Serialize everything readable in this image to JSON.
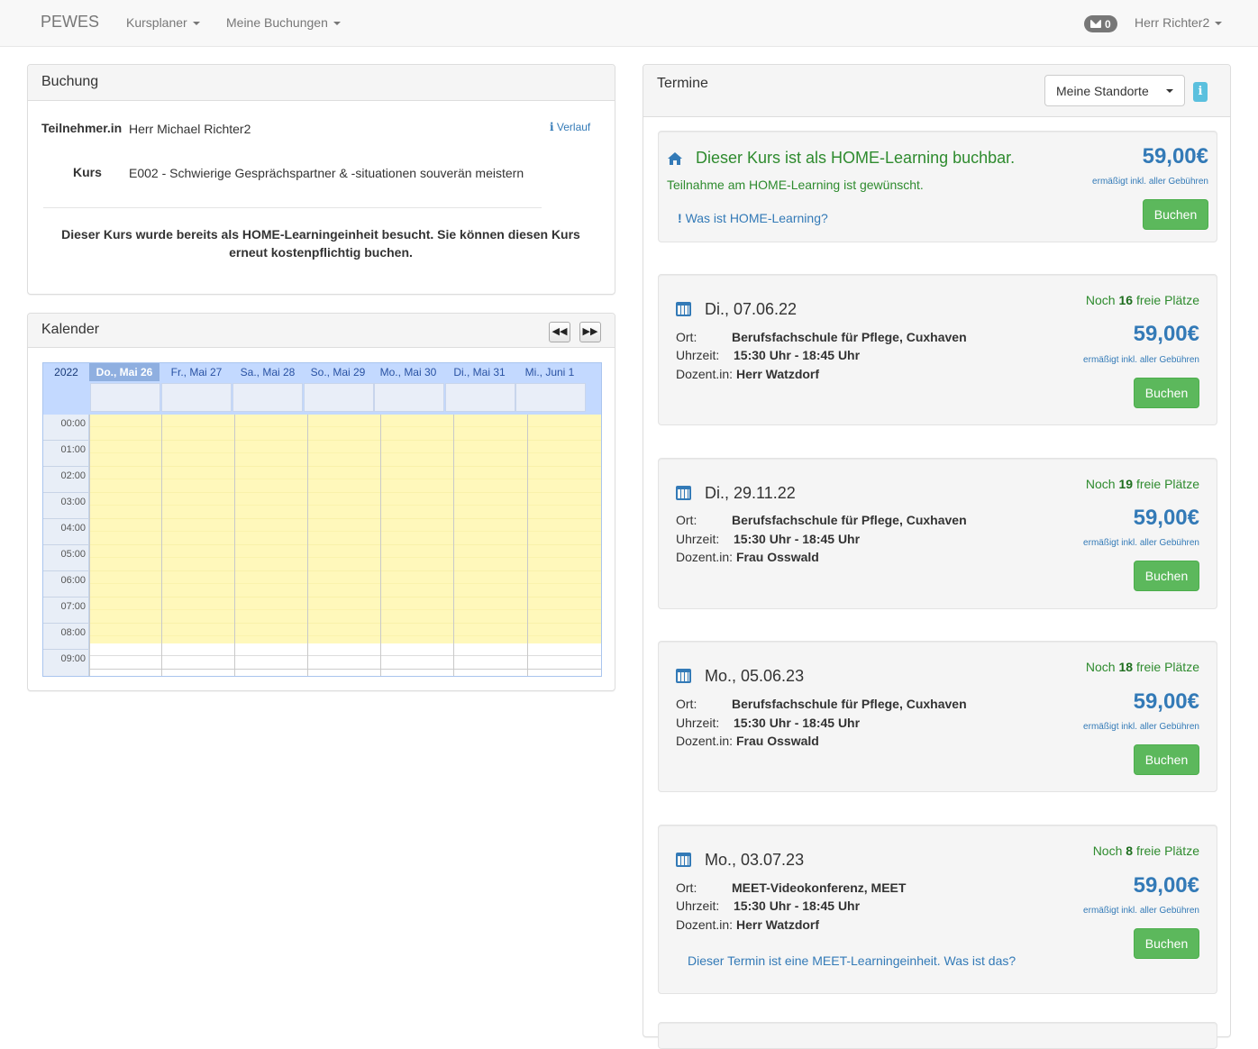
{
  "nav": {
    "brand": "PEWES",
    "kursplaner": "Kursplaner",
    "meine_buchungen": "Meine Buchungen",
    "message_count": "0",
    "user": "Herr Richter2"
  },
  "buchung": {
    "title": "Buchung",
    "teilnehmer_label": "Teilnehmer.in",
    "teilnehmer_value": "Herr Michael Richter2",
    "verlauf": "Verlauf",
    "kurs_label": "Kurs",
    "kurs_value": "E002 - Schwierige Gesprächspartner & -situationen souverän meistern",
    "notice": "Dieser Kurs wurde bereits als HOME-Learningeinheit besucht. Sie können diesen Kurs erneut kostenpflichtig buchen."
  },
  "kalender": {
    "title": "Kalender",
    "prev": "◀◀",
    "next": "▶▶",
    "year": "2022",
    "days": [
      "Do., Mai 26",
      "Fr., Mai 27",
      "Sa., Mai 28",
      "So., Mai 29",
      "Mo., Mai 30",
      "Di., Mai 31",
      "Mi., Juni 1"
    ],
    "hours": [
      "00:00",
      "01:00",
      "02:00",
      "03:00",
      "04:00",
      "05:00",
      "06:00",
      "07:00",
      "08:00",
      "09:00"
    ]
  },
  "termine": {
    "title": "Termine",
    "select": "Meine Standorte",
    "info": "i",
    "home": {
      "title": "Dieser Kurs ist als HOME-Learning buchbar.",
      "sub": "Teilnahme am HOME-Learning ist gewünscht.",
      "link": "Was ist HOME-Learning?",
      "price": "59,00€",
      "price_sub": "ermäßigt inkl. aller Gebühren",
      "button": "Buchen"
    },
    "labels": {
      "ort": "Ort:",
      "uhrzeit": "Uhrzeit:",
      "dozent": "Dozent.in:",
      "noch": "Noch",
      "freie": "freie Plätze"
    },
    "items": [
      {
        "date": "Di., 07.06.22",
        "ort": "Berufsfachschule für Pflege, Cuxhaven",
        "uhrzeit": "15:30 Uhr - 18:45 Uhr",
        "dozent": "Herr Watzdorf",
        "places": "16",
        "price": "59,00€",
        "price_sub": "ermäßigt inkl. aller Gebühren",
        "button": "Buchen"
      },
      {
        "date": "Di., 29.11.22",
        "ort": "Berufsfachschule für Pflege, Cuxhaven",
        "uhrzeit": "15:30 Uhr - 18:45 Uhr",
        "dozent": "Frau Osswald",
        "places": "19",
        "price": "59,00€",
        "price_sub": "ermäßigt inkl. aller Gebühren",
        "button": "Buchen"
      },
      {
        "date": "Mo., 05.06.23",
        "ort": "Berufsfachschule für Pflege, Cuxhaven",
        "uhrzeit": "15:30 Uhr - 18:45 Uhr",
        "dozent": "Frau Osswald",
        "places": "18",
        "price": "59,00€",
        "price_sub": "ermäßigt inkl. aller Gebühren",
        "button": "Buchen"
      },
      {
        "date": "Mo., 03.07.23",
        "ort": "MEET-Videokonferenz, MEET",
        "uhrzeit": "15:30 Uhr - 18:45 Uhr",
        "dozent": "Herr Watzdorf",
        "places": "8",
        "price": "59,00€",
        "price_sub": "ermäßigt inkl. aller Gebühren",
        "button": "Buchen",
        "meet_link": "Dieser Termin ist eine MEET-Learningeinheit. Was ist das?"
      }
    ]
  }
}
